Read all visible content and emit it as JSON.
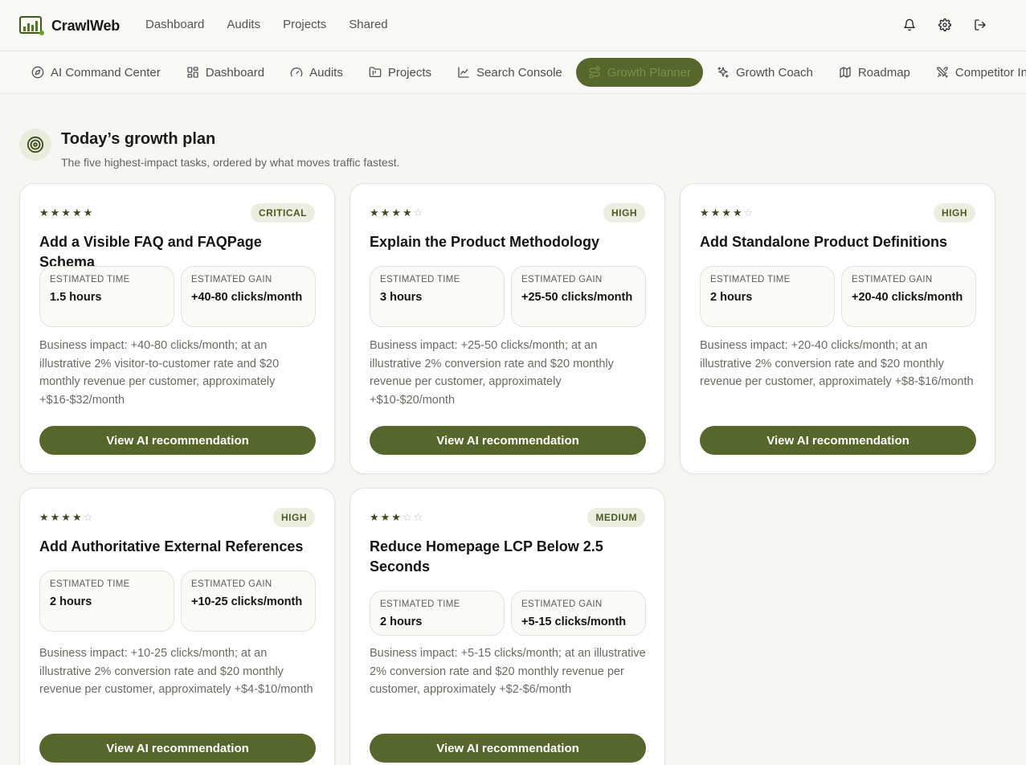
{
  "app": {
    "name": "CrawlWeb"
  },
  "topnav": [
    "Dashboard",
    "Audits",
    "Projects",
    "Shared"
  ],
  "subnav": [
    {
      "label": "AI Command Center",
      "icon": "compass-icon"
    },
    {
      "label": "Dashboard",
      "icon": "grid-icon"
    },
    {
      "label": "Audits",
      "icon": "gauge-icon"
    },
    {
      "label": "Projects",
      "icon": "folder-icon"
    },
    {
      "label": "Search Console",
      "icon": "chart-line-icon"
    },
    {
      "label": "Growth Planner",
      "icon": "route-icon",
      "active": true
    },
    {
      "label": "Growth Coach",
      "icon": "sparkles-icon"
    },
    {
      "label": "Roadmap",
      "icon": "map-icon"
    },
    {
      "label": "Competitor In",
      "icon": "swords-icon"
    }
  ],
  "header": {
    "title": "Today’s growth plan",
    "subtitle": "The five highest-impact tasks, ordered by what moves traffic fastest."
  },
  "labels": {
    "estimated_time": "ESTIMATED TIME",
    "estimated_gain": "ESTIMATED GAIN",
    "cta": "View AI recommendation"
  },
  "colors": {
    "accent": "#57662b",
    "badge_bg": "#ebeedf"
  },
  "tasks": [
    {
      "stars": 5,
      "priority": "CRITICAL",
      "title": "Add a Visible FAQ and FAQPage Schema",
      "time": "1.5 hours",
      "gain": "+40-80 clicks/month",
      "impact": "Business impact: +40-80 clicks/month; at an illustrative 2% visitor-to-customer rate and $20 monthly revenue per customer, approximately +$16-$32/month"
    },
    {
      "stars": 4,
      "priority": "HIGH",
      "title": "Explain the Product Methodology",
      "time": "3 hours",
      "gain": "+25-50 clicks/month",
      "impact": "Business impact: +25-50 clicks/month; at an illustrative 2% conversion rate and $20 monthly revenue per customer, approximately +$10-$20/month"
    },
    {
      "stars": 4,
      "priority": "HIGH",
      "title": "Add Standalone Product Definitions",
      "time": "2 hours",
      "gain": "+20-40 clicks/month",
      "impact": "Business impact: +20-40 clicks/month; at an illustrative 2% conversion rate and $20 monthly revenue per customer, approximately +$8-$16/month"
    },
    {
      "stars": 4,
      "priority": "HIGH",
      "title": "Add Authoritative External References",
      "time": "2 hours",
      "gain": "+10-25 clicks/month",
      "impact": "Business impact: +10-25 clicks/month; at an illustrative 2% conversion rate and $20 monthly revenue per customer, approximately +$4-$10/month"
    },
    {
      "stars": 3,
      "priority": "MEDIUM",
      "title": "Reduce Homepage LCP Below 2.5 Seconds",
      "time": "2 hours",
      "gain": "+5-15 clicks/month",
      "impact": "Business impact: +5-15 clicks/month; at an illustrative 2% conversion rate and $20 monthly revenue per customer, approximately +$2-$6/month"
    }
  ]
}
